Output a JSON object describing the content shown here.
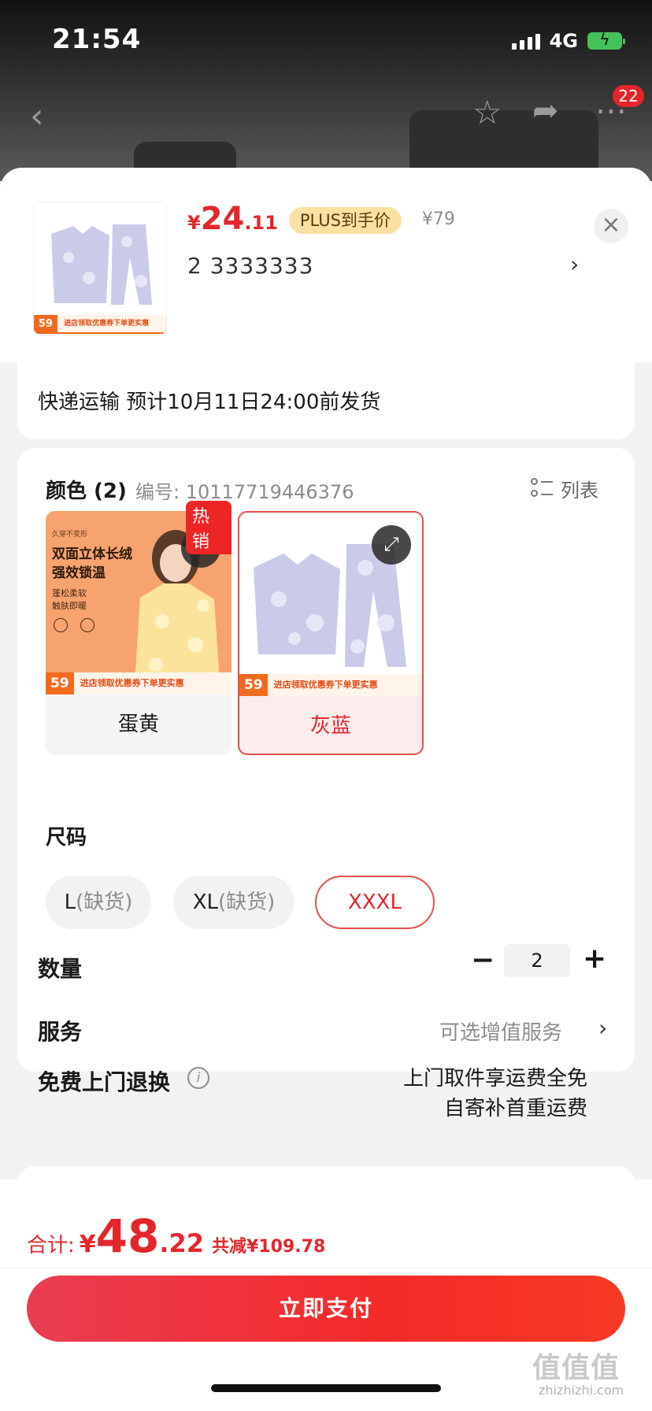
{
  "status": {
    "time": "21:54",
    "network": "4G"
  },
  "nav": {
    "badge": "22"
  },
  "sku": {
    "price_symbol": "¥",
    "price_int": "24",
    "price_dec": ".11",
    "plus_tag": "PLUS到手价",
    "orig_price": "¥79",
    "selected_spec": "2  3333333",
    "thumb_promo_price": "59",
    "thumb_promo_text": "进店领取优惠券下单更实惠"
  },
  "shipping": {
    "text": "快递运输 预计10月11日24:00前发货"
  },
  "color": {
    "label": "颜色 (2)",
    "code": "编号: 10117719446376",
    "list_label": "列表",
    "options": [
      {
        "name": "蛋黄",
        "hot_tag": "热销",
        "ad_small": "久穿不变形",
        "ad_title_1": "双面立体长绒",
        "ad_title_2": "强效锁温",
        "ad_sub_1": "蓬松柔软",
        "ad_sub_2": "触肤即暖",
        "promo_price": "59",
        "promo_text": "进店领取优惠券下单更实惠"
      },
      {
        "name": "灰蓝",
        "promo_price": "59",
        "promo_text": "进店领取优惠券下单更实惠"
      }
    ]
  },
  "size": {
    "label": "尺码",
    "options": [
      {
        "name": "L",
        "note": "(缺货)"
      },
      {
        "name": "XL",
        "note": "(缺货)"
      },
      {
        "name": "XXXL",
        "note": ""
      }
    ]
  },
  "quantity": {
    "label": "数量",
    "value": "2",
    "minus": "−",
    "plus": "+"
  },
  "service": {
    "label": "服务",
    "value": "可选增值服务"
  },
  "free_return": {
    "label": "免费上门退换",
    "line1": "上门取件享运费全免",
    "line2": "自寄补首重运费"
  },
  "footer": {
    "total_label": "合计:",
    "total_symbol": "¥",
    "total_int": "48",
    "total_dec": ".22",
    "saved": "共减¥109.78",
    "pay_button": "立即支付",
    "watermark": "值值值",
    "watermark_sub": "zhizhizhi.com"
  },
  "colors": {
    "accent": "#e4262c",
    "plus_tag_bg": "#fbe1a1",
    "promo_orange": "#f26b1d"
  }
}
